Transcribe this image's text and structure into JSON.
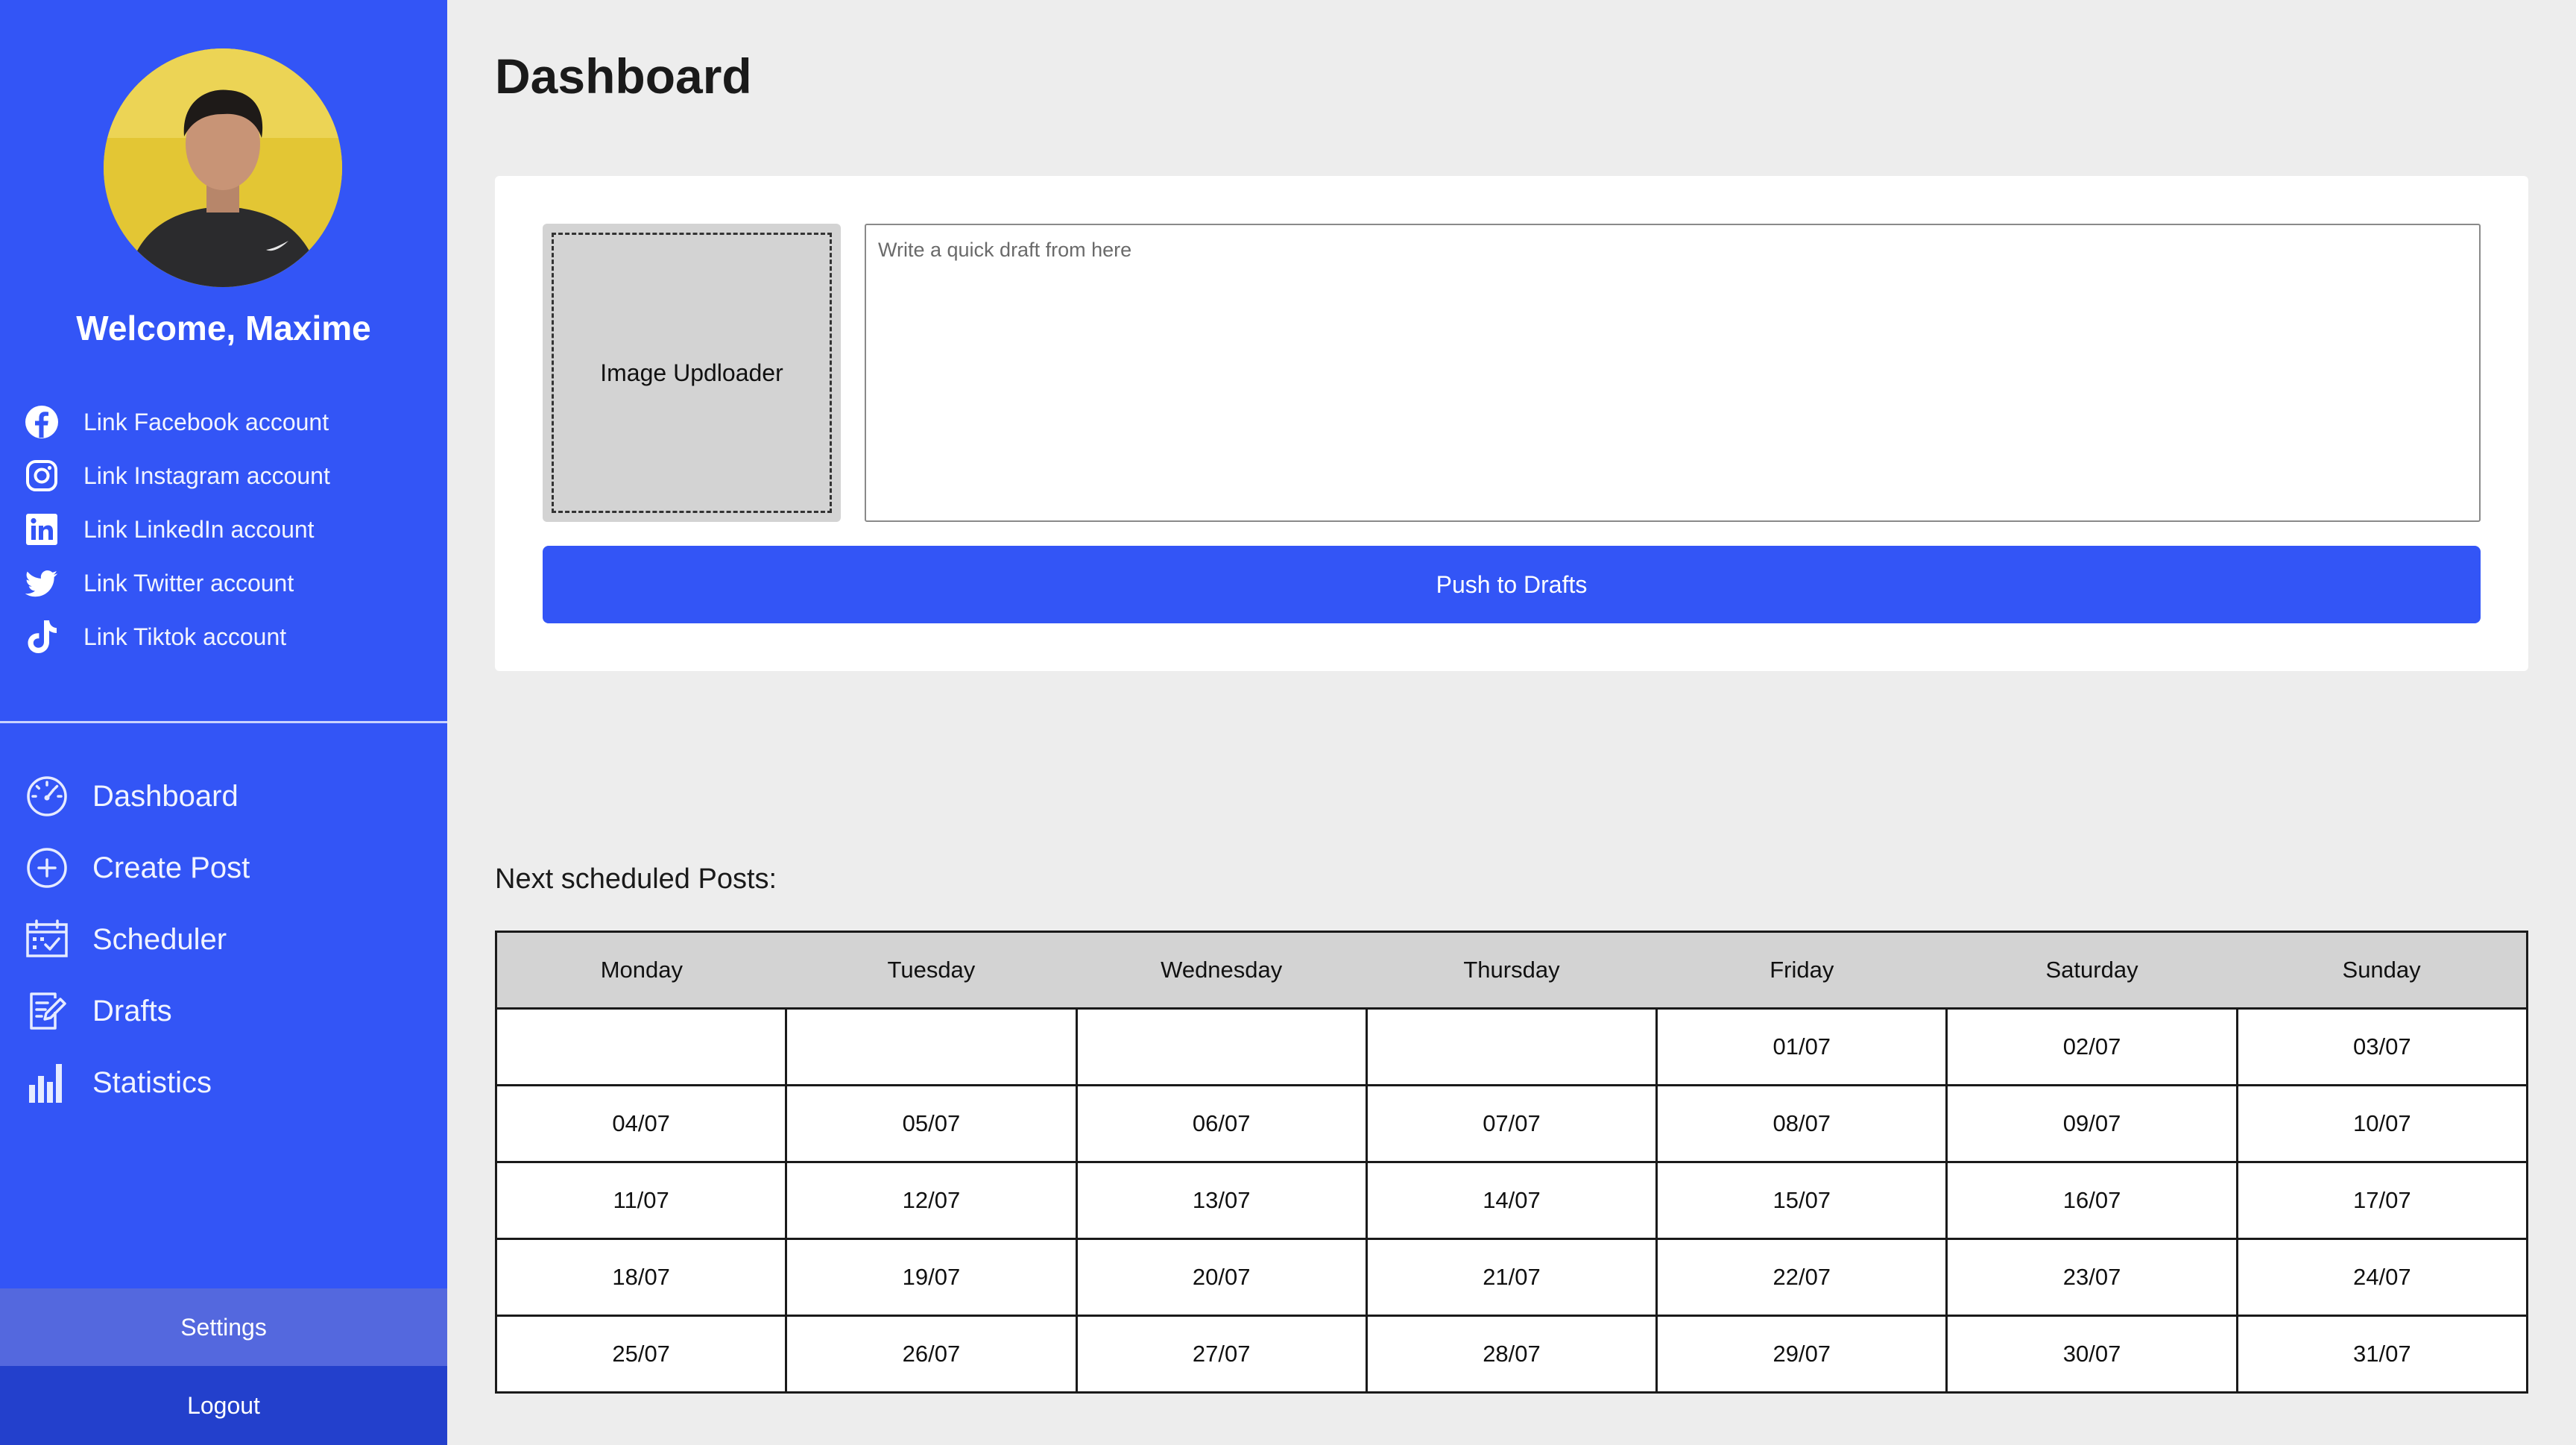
{
  "user": {
    "welcome": "Welcome, Maxime"
  },
  "social_links": [
    {
      "icon": "facebook-icon",
      "label": "Link Facebook account"
    },
    {
      "icon": "instagram-icon",
      "label": "Link Instagram account"
    },
    {
      "icon": "linkedin-icon",
      "label": "Link LinkedIn account"
    },
    {
      "icon": "twitter-icon",
      "label": "Link Twitter account"
    },
    {
      "icon": "tiktok-icon",
      "label": "Link Tiktok account"
    }
  ],
  "nav": [
    {
      "icon": "speedometer-icon",
      "label": "Dashboard"
    },
    {
      "icon": "plus-circle-icon",
      "label": "Create Post"
    },
    {
      "icon": "calendar-icon",
      "label": "Scheduler"
    },
    {
      "icon": "edit-document-icon",
      "label": "Drafts"
    },
    {
      "icon": "bar-chart-icon",
      "label": "Statistics"
    }
  ],
  "footer": {
    "settings_label": "Settings",
    "logout_label": "Logout"
  },
  "page": {
    "title": "Dashboard"
  },
  "draft": {
    "uploader_label": "Image Updloader",
    "placeholder": "Write a quick draft from here",
    "push_label": "Push to Drafts"
  },
  "schedule": {
    "label": "Next scheduled Posts:",
    "days": [
      "Monday",
      "Tuesday",
      "Wednesday",
      "Thursday",
      "Friday",
      "Saturday",
      "Sunday"
    ],
    "weeks": [
      [
        "",
        "",
        "",
        "",
        "01/07",
        "02/07",
        "03/07"
      ],
      [
        "04/07",
        "05/07",
        "06/07",
        "07/07",
        "08/07",
        "09/07",
        "10/07"
      ],
      [
        "11/07",
        "12/07",
        "13/07",
        "14/07",
        "15/07",
        "16/07",
        "17/07"
      ],
      [
        "18/07",
        "19/07",
        "20/07",
        "21/07",
        "22/07",
        "23/07",
        "24/07"
      ],
      [
        "25/07",
        "26/07",
        "27/07",
        "28/07",
        "29/07",
        "30/07",
        "31/07"
      ]
    ]
  },
  "colors": {
    "sidebar": "#3355f6",
    "settings_bg": "#5468de",
    "logout_bg": "#2340cc",
    "accent": "#3355f6",
    "page_bg": "#ededed"
  }
}
